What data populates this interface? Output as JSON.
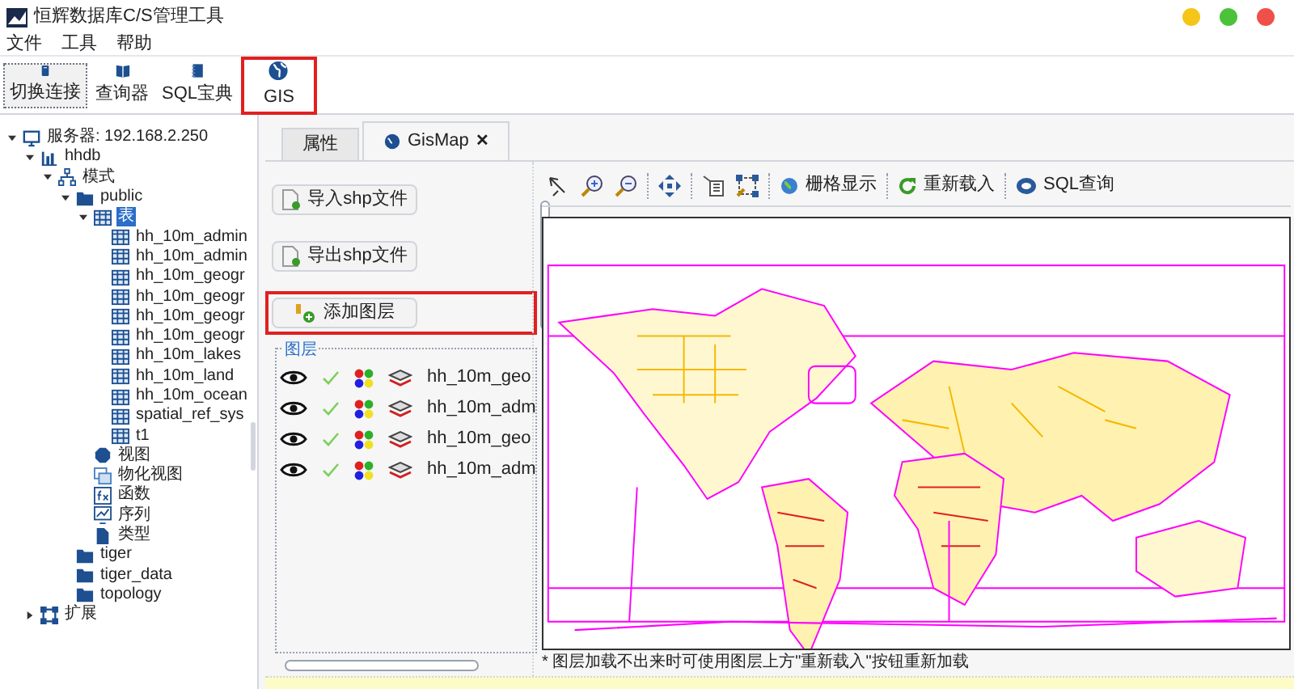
{
  "window": {
    "title": "恒辉数据库C/S管理工具"
  },
  "menu": [
    "文件",
    "工具",
    "帮助"
  ],
  "toolbar": [
    {
      "label": "切换连接",
      "kind": "switch",
      "selected": true,
      "highlighted": false
    },
    {
      "label": "查询器",
      "kind": "book",
      "selected": false,
      "highlighted": false
    },
    {
      "label": "SQL宝典",
      "kind": "notebook",
      "selected": false,
      "highlighted": false
    },
    {
      "label": "GIS",
      "kind": "globe",
      "selected": false,
      "highlighted": true
    }
  ],
  "tree": [
    {
      "label": "服务器: 192.168.2.250",
      "kind": "server",
      "expanded": true,
      "selected": false,
      "children": [
        {
          "label": "hhdb",
          "kind": "database",
          "expanded": true,
          "selected": false,
          "children": [
            {
              "label": "模式",
              "kind": "schema",
              "expanded": true,
              "selected": false,
              "children": [
                {
                  "label": "public",
                  "kind": "folder",
                  "expanded": true,
                  "selected": false,
                  "children": [
                    {
                      "label": "表",
                      "kind": "tables",
                      "expanded": true,
                      "selected": true,
                      "children": [
                        {
                          "label": "hh_10m_admin",
                          "kind": "table",
                          "selected": false
                        },
                        {
                          "label": "hh_10m_admin",
                          "kind": "table",
                          "selected": false
                        },
                        {
                          "label": "hh_10m_geogr",
                          "kind": "table",
                          "selected": false
                        },
                        {
                          "label": "hh_10m_geogr",
                          "kind": "table",
                          "selected": false
                        },
                        {
                          "label": "hh_10m_geogr",
                          "kind": "table",
                          "selected": false
                        },
                        {
                          "label": "hh_10m_geogr",
                          "kind": "table",
                          "selected": false
                        },
                        {
                          "label": "hh_10m_lakes",
                          "kind": "table",
                          "selected": false
                        },
                        {
                          "label": "hh_10m_land",
                          "kind": "table",
                          "selected": false
                        },
                        {
                          "label": "hh_10m_ocean",
                          "kind": "table",
                          "selected": false
                        },
                        {
                          "label": "spatial_ref_sys",
                          "kind": "table",
                          "selected": false
                        },
                        {
                          "label": "t1",
                          "kind": "table",
                          "selected": false
                        }
                      ]
                    },
                    {
                      "label": "视图",
                      "kind": "view",
                      "selected": false
                    },
                    {
                      "label": "物化视图",
                      "kind": "matview",
                      "selected": false
                    },
                    {
                      "label": "函数",
                      "kind": "function",
                      "selected": false
                    },
                    {
                      "label": "序列",
                      "kind": "sequence",
                      "selected": false
                    },
                    {
                      "label": "类型",
                      "kind": "type",
                      "selected": false
                    }
                  ]
                },
                {
                  "label": "tiger",
                  "kind": "folder",
                  "selected": false
                },
                {
                  "label": "tiger_data",
                  "kind": "folder",
                  "selected": false
                },
                {
                  "label": "topology",
                  "kind": "folder",
                  "selected": false
                }
              ]
            }
          ]
        },
        {
          "label": "扩展",
          "kind": "extension",
          "expanded": false,
          "selected": false
        }
      ]
    }
  ],
  "tabs": [
    {
      "label": "属性",
      "selected": false,
      "closable": false
    },
    {
      "label": "GisMap",
      "selected": true,
      "closable": true,
      "close_glyph": "✕"
    }
  ],
  "actions": [
    {
      "label": "导入shp文件",
      "kind": "import",
      "highlighted": false
    },
    {
      "label": "导出shp文件",
      "kind": "export",
      "highlighted": false
    },
    {
      "label": "添加图层",
      "kind": "add",
      "highlighted": true
    }
  ],
  "layers": {
    "title": "图层",
    "items": [
      {
        "name": "hh_10m_geo",
        "visible": true,
        "checked": true
      },
      {
        "name": "hh_10m_adm",
        "visible": true,
        "checked": true
      },
      {
        "name": "hh_10m_geo",
        "visible": true,
        "checked": true
      },
      {
        "name": "hh_10m_adm",
        "visible": true,
        "checked": true
      }
    ]
  },
  "map_toolbar": [
    {
      "kind": "select"
    },
    {
      "kind": "zoom-in"
    },
    {
      "kind": "zoom-out"
    },
    {
      "kind": "pan"
    },
    {
      "kind": "identify"
    },
    {
      "kind": "extent"
    },
    {
      "kind": "grid",
      "label": "栅格显示"
    },
    {
      "kind": "reload",
      "label": "重新载入"
    },
    {
      "kind": "sql",
      "label": "SQL查询"
    }
  ],
  "note": "* 图层加载不出来时可使用图层上方\"重新载入\"按钮重新加载"
}
